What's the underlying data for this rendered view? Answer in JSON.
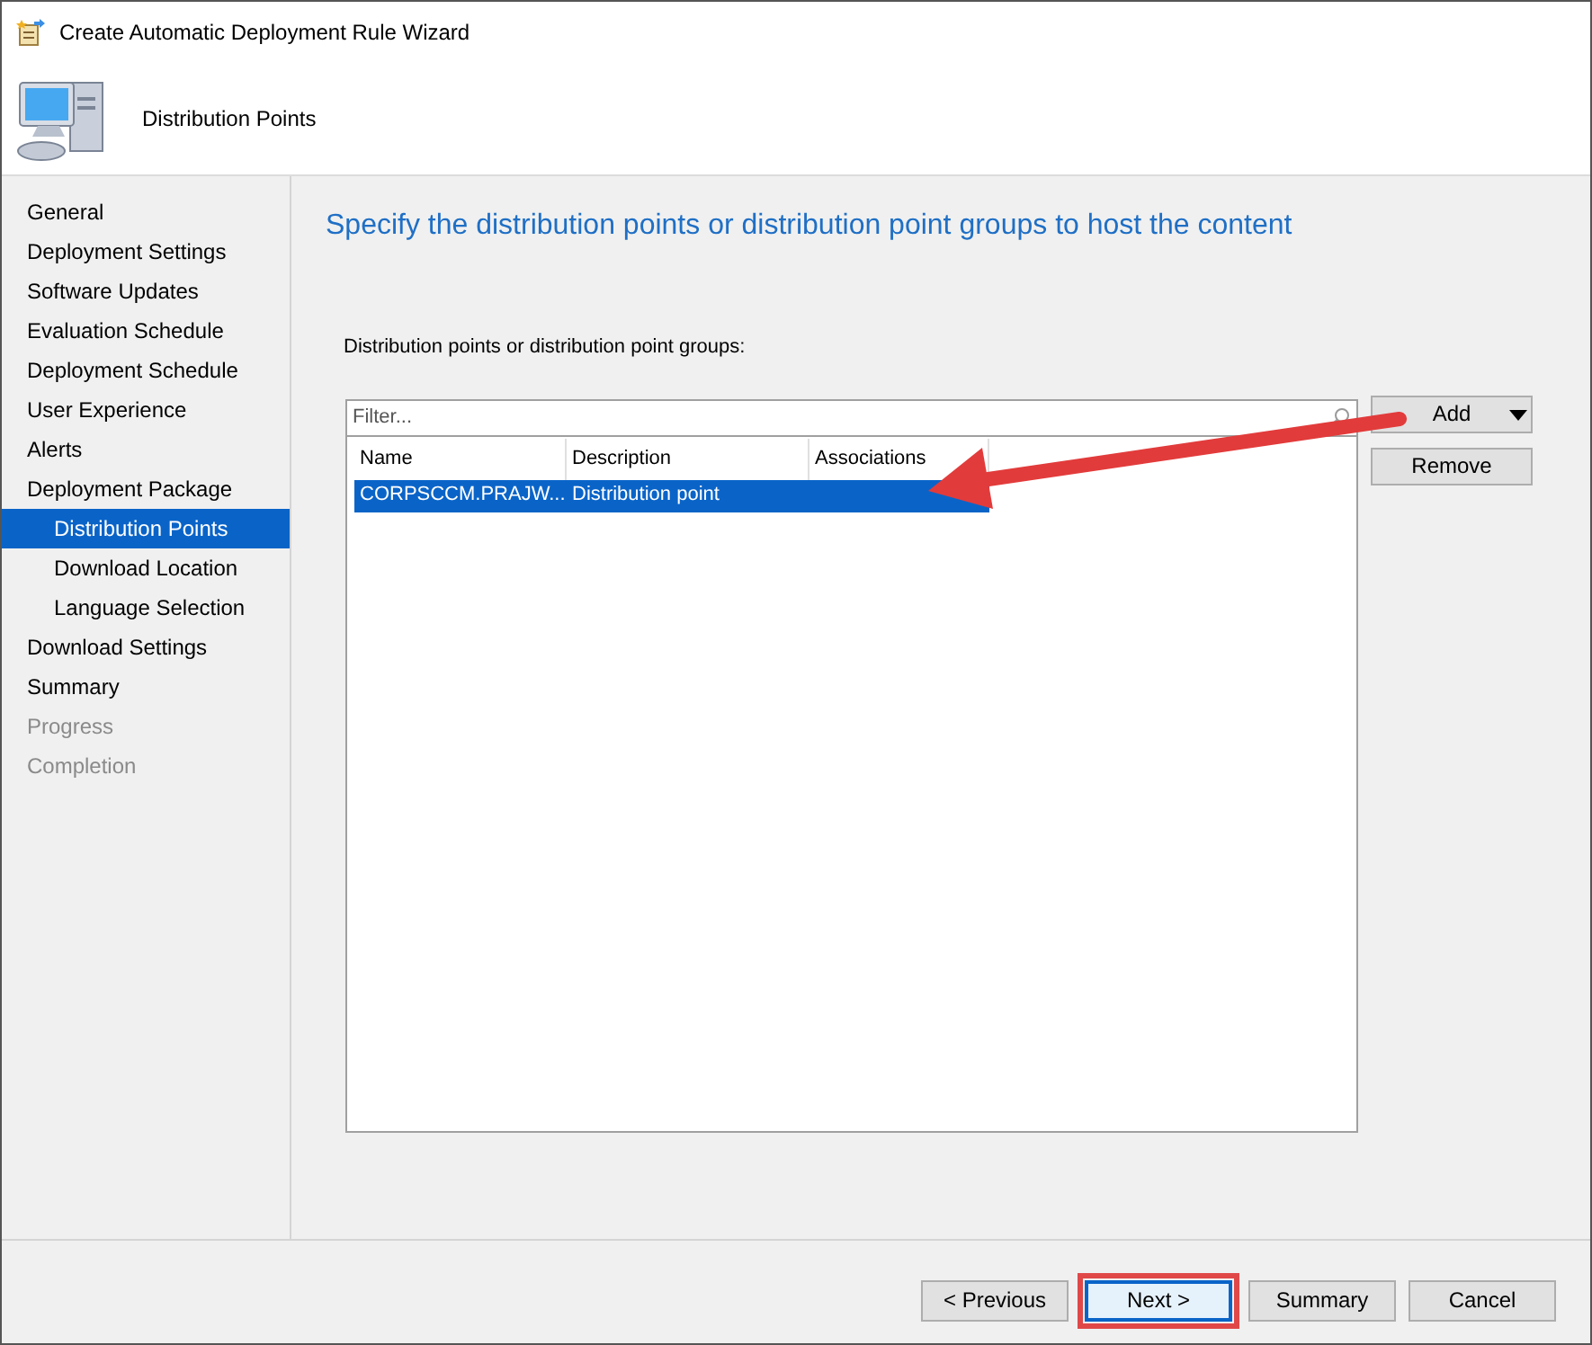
{
  "window": {
    "title": "Create Automatic Deployment Rule Wizard"
  },
  "header": {
    "title": "Distribution Points"
  },
  "steps": [
    {
      "label": "General",
      "selected": false,
      "disabled": false
    },
    {
      "label": "Deployment Settings",
      "selected": false,
      "disabled": false
    },
    {
      "label": "Software Updates",
      "selected": false,
      "disabled": false
    },
    {
      "label": "Evaluation Schedule",
      "selected": false,
      "disabled": false
    },
    {
      "label": "Deployment Schedule",
      "selected": false,
      "disabled": false
    },
    {
      "label": "User Experience",
      "selected": false,
      "disabled": false
    },
    {
      "label": "Alerts",
      "selected": false,
      "disabled": false
    },
    {
      "label": "Deployment Package",
      "selected": false,
      "disabled": false,
      "children": [
        {
          "label": "Distribution Points",
          "selected": true,
          "disabled": false
        },
        {
          "label": "Download Location",
          "selected": false,
          "disabled": false
        },
        {
          "label": "Language Selection",
          "selected": false,
          "disabled": false
        }
      ]
    },
    {
      "label": "Download Settings",
      "selected": false,
      "disabled": false
    },
    {
      "label": "Summary",
      "selected": false,
      "disabled": false
    },
    {
      "label": "Progress",
      "selected": false,
      "disabled": true
    },
    {
      "label": "Completion",
      "selected": false,
      "disabled": true
    }
  ],
  "content": {
    "heading": "Specify the distribution points or distribution point groups to host the content",
    "list_label": "Distribution points or distribution point groups:",
    "filter": {
      "placeholder": "Filter..."
    },
    "table": {
      "columns": [
        "Name",
        "Description",
        "Associations"
      ],
      "rows": [
        {
          "cells": [
            "CORPSCCM.PRAJW...",
            "Distribution point",
            ""
          ],
          "selected": true
        }
      ]
    },
    "side_buttons": [
      {
        "label": "Add",
        "dropdown": true
      },
      {
        "label": "Remove",
        "dropdown": false
      }
    ]
  },
  "annotations": {
    "arrow_to_row": true,
    "highlight_next": true
  },
  "footer_buttons": [
    {
      "label": "< Previous",
      "kind": "previous"
    },
    {
      "label": "Next >",
      "kind": "next"
    },
    {
      "label": "Summary",
      "kind": "summary"
    },
    {
      "label": "Cancel",
      "kind": "cancel"
    }
  ]
}
